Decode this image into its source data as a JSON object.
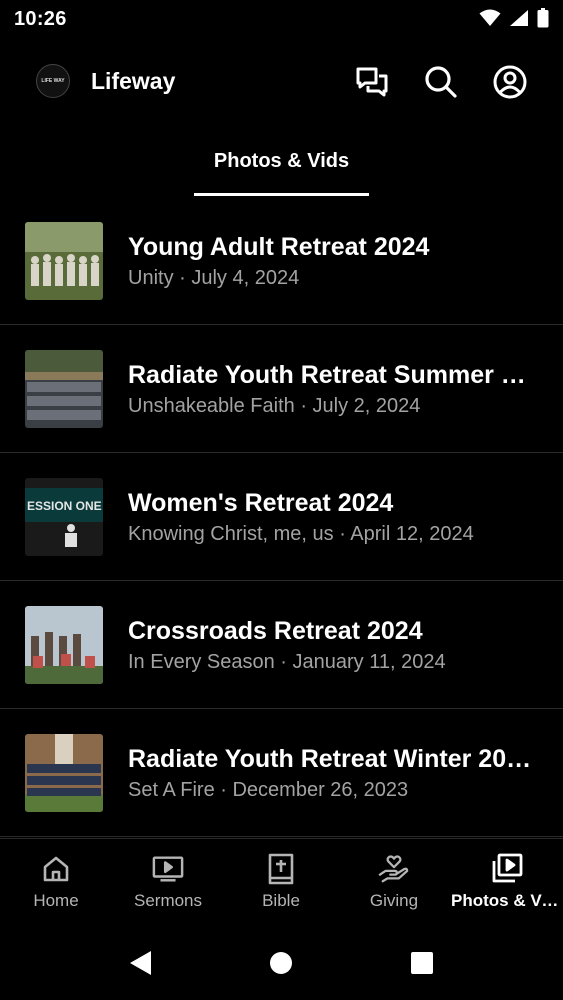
{
  "status": {
    "time": "10:26"
  },
  "header": {
    "title": "Lifeway",
    "logo_text": "LIFE WAY"
  },
  "tabs": [
    {
      "label": "Photos & Vids",
      "active": true
    }
  ],
  "albums": [
    {
      "title": "Young Adult Retreat 2024",
      "subtitle": "Unity · July 4, 2024",
      "thumb_colors": [
        "#5a6b3a",
        "#d9d4c8",
        "#8a9a6a"
      ]
    },
    {
      "title": "Radiate Youth Retreat Summer 2…",
      "subtitle": "Unshakeable Faith · July 2, 2024",
      "thumb_colors": [
        "#4b5a3a",
        "#6a6f78",
        "#3a3f45"
      ]
    },
    {
      "title": "Women's Retreat 2024",
      "subtitle": "Knowing Christ, me, us · April 12, 2024",
      "thumb_colors": [
        "#0b3a3a",
        "#1a1a1a",
        "#e0e0e0"
      ],
      "thumb_text": "ESSION ONE"
    },
    {
      "title": "Crossroads Retreat 2024",
      "subtitle": "In Every Season · January 11, 2024",
      "thumb_colors": [
        "#b9c6cf",
        "#5a4a40",
        "#c0504a"
      ]
    },
    {
      "title": "Radiate Youth Retreat Winter 20…",
      "subtitle": "Set A Fire · December 26, 2023",
      "thumb_colors": [
        "#8a6a4a",
        "#2a3550",
        "#5a7a3a"
      ]
    }
  ],
  "bottom_nav": [
    {
      "label": "Home",
      "icon": "home-icon",
      "active": false
    },
    {
      "label": "Sermons",
      "icon": "tv-play-icon",
      "active": false
    },
    {
      "label": "Bible",
      "icon": "bible-icon",
      "active": false
    },
    {
      "label": "Giving",
      "icon": "giving-hand-icon",
      "active": false
    },
    {
      "label": "Photos & Vi…",
      "icon": "media-library-icon",
      "active": true
    }
  ],
  "colors": {
    "background": "#000000",
    "text": "#ffffff",
    "subtext": "#a3a3a3",
    "divider": "#2a2a2a"
  }
}
